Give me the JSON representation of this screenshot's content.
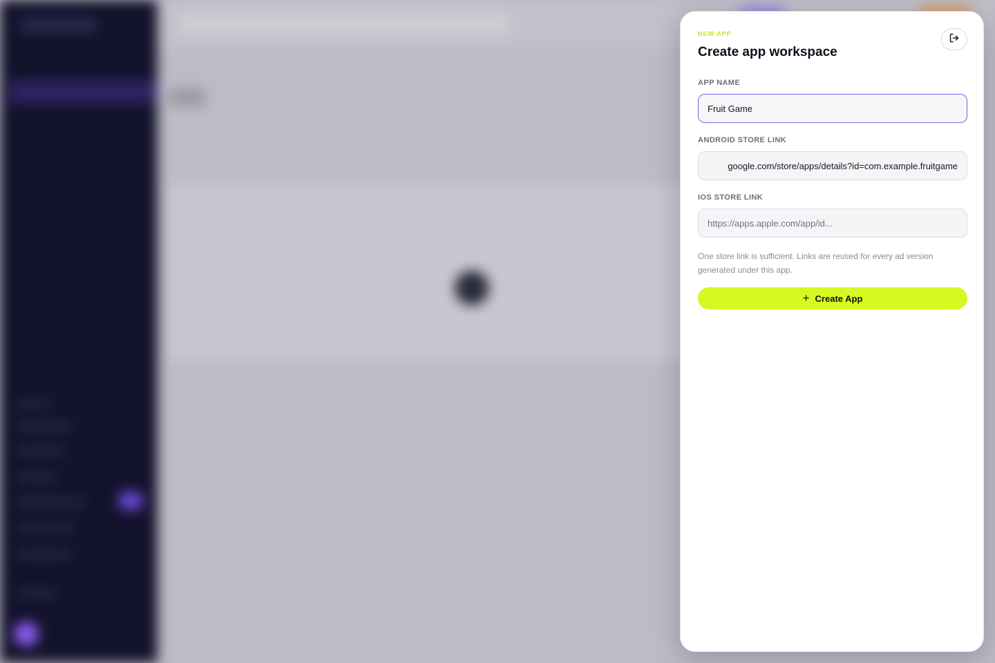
{
  "modal": {
    "eyebrow": "NEW APP",
    "title": "Create app workspace",
    "exit_icon": "exit-icon",
    "fields": {
      "app_name": {
        "label": "APP NAME",
        "value": "Fruit Game"
      },
      "android_link": {
        "label": "ANDROID STORE LINK",
        "value": "google.com/store/apps/details?id=com.example.fruitgame"
      },
      "ios_link": {
        "label": "IOS STORE LINK",
        "value": "",
        "placeholder": "https://apps.apple.com/app/id..."
      }
    },
    "hint": "One store link is sufficient. Links are reused for every ad version generated under this app.",
    "create_button": {
      "icon": "plus-icon",
      "label": "Create App"
    }
  },
  "colors": {
    "accent_lime": "#d4fa21",
    "focus_purple": "#8a63e8",
    "sidebar_dark": "#13122b"
  }
}
